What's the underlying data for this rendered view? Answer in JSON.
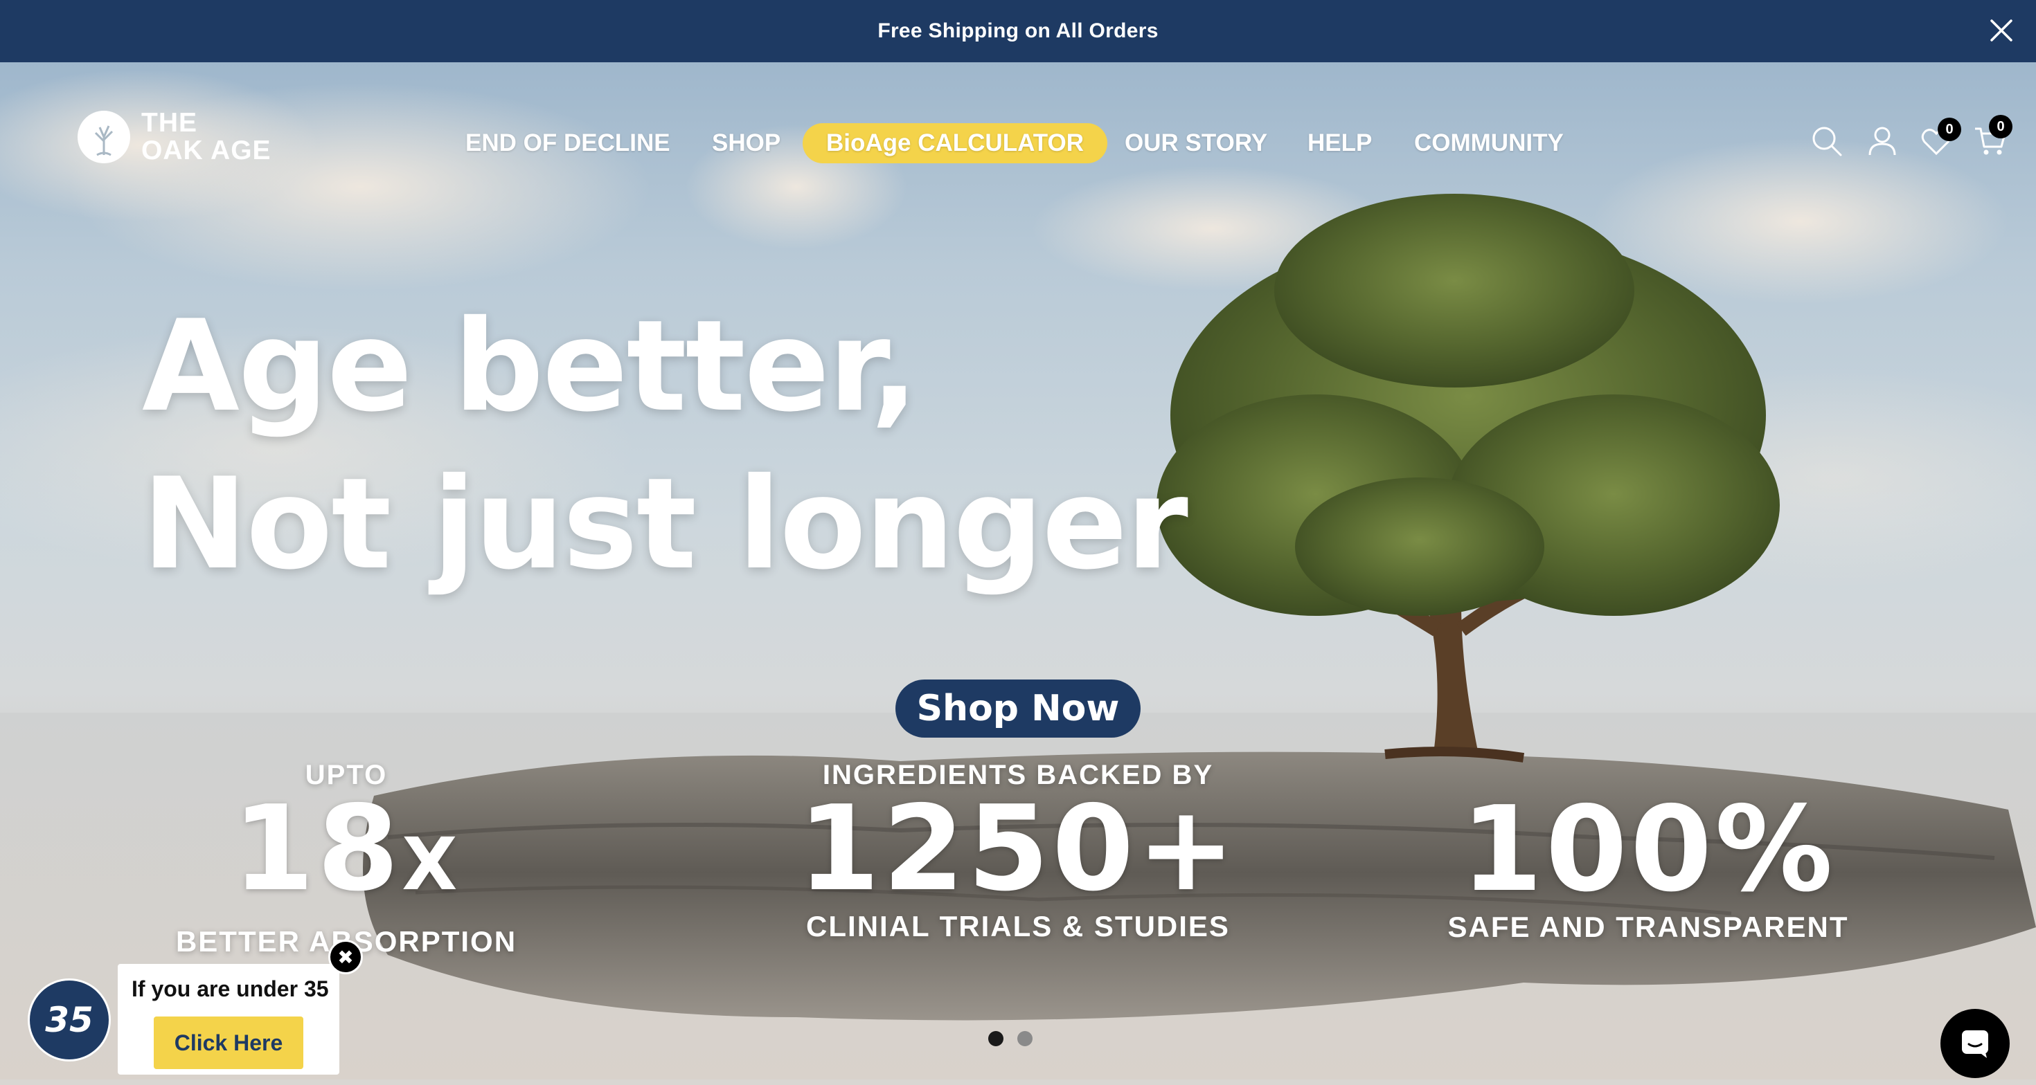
{
  "announcement": {
    "text": "Free Shipping on All Orders",
    "close_icon": "close-icon"
  },
  "brand": {
    "line1": "THE",
    "line2": "OAK AGE"
  },
  "nav": [
    {
      "label": "END OF DECLINE"
    },
    {
      "label": "SHOP"
    },
    {
      "label": "BioAge CALCULATOR",
      "highlighted": true
    },
    {
      "label": "OUR STORY"
    },
    {
      "label": "HELP"
    },
    {
      "label": "COMMUNITY"
    }
  ],
  "header_icons": {
    "search": "search-icon",
    "account": "user-icon",
    "wishlist": {
      "icon": "heart-icon",
      "count": "0"
    },
    "cart": {
      "icon": "cart-icon",
      "count": "0"
    }
  },
  "hero": {
    "headline_line1": "Age better,",
    "headline_line2": "Not just longer",
    "cta": "Shop Now"
  },
  "stats": [
    {
      "pre": "UPTO",
      "value": "18",
      "suffix": "X",
      "post": "BETTER ABSORPTION"
    },
    {
      "pre": "INGREDIENTS BACKED BY",
      "value": "1250+",
      "post": "CLINIAL TRIALS & STUDIES"
    },
    {
      "pre": "",
      "value": "100%",
      "post": "SAFE AND TRANSPARENT"
    }
  ],
  "age_popup": {
    "badge": "35",
    "message": "If you are under 35",
    "button": "Click Here",
    "close": "✖"
  },
  "slider": {
    "total": 2,
    "active": 1
  },
  "colors": {
    "navy": "#1e3a63",
    "yellow": "#f4d34a",
    "white": "#ffffff"
  }
}
